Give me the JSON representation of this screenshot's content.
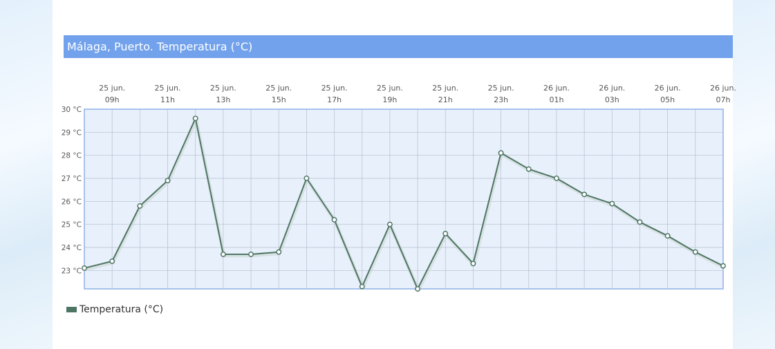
{
  "title": "Málaga, Puerto. Temperatura (°C)",
  "legend": {
    "label": "Temperatura (°C)"
  },
  "colors": {
    "header": "#72a2ec",
    "plot_bg": "#e8f0fb",
    "plot_border": "#8fb1e8",
    "grid": "#b3bfcc",
    "line": "#4e7564",
    "marker_fill": "#ffffff"
  },
  "chart_data": {
    "type": "line",
    "x_ticks": [
      {
        "date": "25 jun.",
        "hour": "09h"
      },
      {
        "date": "25 jun.",
        "hour": "11h"
      },
      {
        "date": "25 jun.",
        "hour": "13h"
      },
      {
        "date": "25 jun.",
        "hour": "15h"
      },
      {
        "date": "25 jun.",
        "hour": "17h"
      },
      {
        "date": "25 jun.",
        "hour": "19h"
      },
      {
        "date": "25 jun.",
        "hour": "21h"
      },
      {
        "date": "25 jun.",
        "hour": "23h"
      },
      {
        "date": "26 jun.",
        "hour": "01h"
      },
      {
        "date": "26 jun.",
        "hour": "03h"
      },
      {
        "date": "26 jun.",
        "hour": "05h"
      },
      {
        "date": "26 jun.",
        "hour": "07h"
      }
    ],
    "y_ticks": [
      "23 °C",
      "24 °C",
      "25 °C",
      "26 °C",
      "27 °C",
      "28 °C",
      "29 °C",
      "30 °C"
    ],
    "ylim": [
      22.2,
      30
    ],
    "x": [
      "25 jun. 08h",
      "25 jun. 09h",
      "25 jun. 10h",
      "25 jun. 11h",
      "25 jun. 12h",
      "25 jun. 13h",
      "25 jun. 14h",
      "25 jun. 15h",
      "25 jun. 16h",
      "25 jun. 17h",
      "25 jun. 18h",
      "25 jun. 19h",
      "25 jun. 20h",
      "25 jun. 21h",
      "25 jun. 22h",
      "25 jun. 23h",
      "26 jun. 00h",
      "26 jun. 01h",
      "26 jun. 02h",
      "26 jun. 03h",
      "26 jun. 04h",
      "26 jun. 05h",
      "26 jun. 06h",
      "26 jun. 07h"
    ],
    "series": [
      {
        "name": "Temperatura (°C)",
        "values": [
          23.1,
          23.4,
          25.8,
          26.9,
          29.6,
          23.7,
          23.7,
          23.8,
          27.0,
          25.2,
          22.3,
          25.0,
          22.2,
          24.6,
          23.3,
          28.1,
          27.4,
          27.0,
          26.3,
          25.9,
          25.1,
          24.5,
          23.8,
          23.2
        ]
      }
    ],
    "grid": true,
    "legend_position": "bottom-left"
  }
}
